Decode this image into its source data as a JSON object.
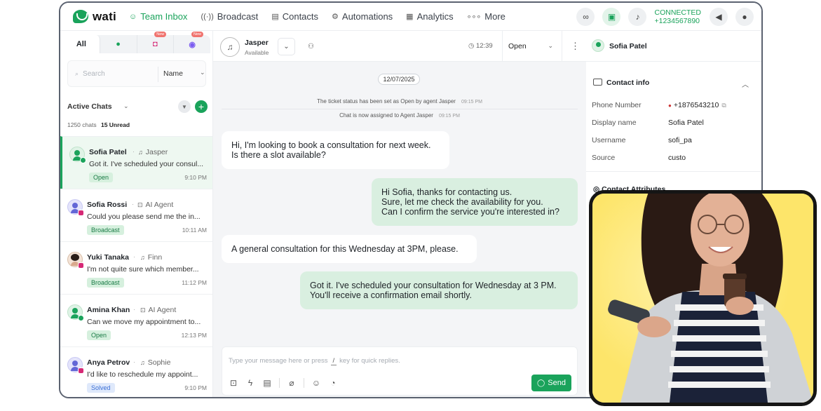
{
  "brand": {
    "name": "wati"
  },
  "nav": {
    "items": [
      {
        "label": "Team Inbox",
        "icon": "inbox-icon",
        "active": true
      },
      {
        "label": "Broadcast",
        "icon": "broadcast-icon"
      },
      {
        "label": "Contacts",
        "icon": "contacts-icon"
      },
      {
        "label": "Automations",
        "icon": "automations-icon"
      },
      {
        "label": "Analytics",
        "icon": "analytics-icon"
      },
      {
        "label": "More",
        "icon": "more-icon"
      }
    ],
    "status": "CONNECTED",
    "phone": "+1234567890"
  },
  "channels": {
    "all": "All",
    "new_badge": "New"
  },
  "search": {
    "placeholder": "Search",
    "sort": "Name"
  },
  "list": {
    "header": "Active Chats",
    "total": "1250 chats",
    "unread": "15 Unread",
    "chats": [
      {
        "name": "Sofia Patel",
        "agent": "Jasper",
        "agent_type": "human",
        "message": "Got it. I've scheduled your consul...",
        "tag": "Open",
        "time": "9:10 PM",
        "source": "whatsapp"
      },
      {
        "name": "Sofia Rossi",
        "agent": "AI Agent",
        "agent_type": "ai",
        "message": "Could you please send me the in...",
        "tag": "Broadcast",
        "time": "10:11 AM",
        "source": "instagram"
      },
      {
        "name": "Yuki Tanaka",
        "agent": "Finn",
        "agent_type": "human",
        "message": "I'm not quite sure which member...",
        "tag": "Broadcast",
        "time": "11:12 PM",
        "source": "instagram"
      },
      {
        "name": "Amina Khan",
        "agent": "AI Agent",
        "agent_type": "ai",
        "message": "Can we move my appointment to...",
        "tag": "Open",
        "time": "12:13 PM",
        "source": "whatsapp"
      },
      {
        "name": "Anya Petrov",
        "agent": "Sophie",
        "agent_type": "human",
        "message": "I'd like to reschedule my appoint...",
        "tag": "Solved",
        "time": "9:10 PM",
        "source": "instagram"
      }
    ]
  },
  "conversation": {
    "agent_name": "Jasper",
    "agent_status": "Available",
    "timer": "12:39",
    "status": "Open",
    "date": "12/07/2025",
    "system": [
      {
        "text": "The ticket status has been set as Open by agent Jasper",
        "time": "09:15 PM"
      },
      {
        "text": "Chat is now assigned to Agent Jasper",
        "time": "09:15 PM"
      }
    ],
    "messages": [
      {
        "dir": "in",
        "lines": [
          "Hi, I'm looking to book a consultation for next week.",
          "Is there a slot available?"
        ]
      },
      {
        "dir": "out",
        "lines": [
          "Hi Sofia, thanks for contacting us.",
          "Sure, let me check the availability for you.",
          "Can I confirm the service you're interested in?"
        ]
      },
      {
        "dir": "in",
        "lines": [
          "A general consultation for this Wednesday at 3PM, please."
        ]
      },
      {
        "dir": "out",
        "lines": [
          "Got it. I've scheduled your consultation for Wednesday at 3 PM.",
          "You'll receive a confirmation email shortly."
        ]
      }
    ],
    "composer_placeholder_a": "Type your message here or press",
    "composer_key": "/",
    "composer_placeholder_b": "key for quick replies.",
    "send_label": "Send"
  },
  "contact": {
    "name": "Sofia Patel",
    "section_title": "Contact info",
    "fields": [
      {
        "label": "Phone Number",
        "value": "+1876543210"
      },
      {
        "label": "Display name",
        "value": "Sofia Patel"
      },
      {
        "label": "Username",
        "value": "sofi_pa"
      },
      {
        "label": "Source",
        "value": "custo"
      }
    ],
    "attributes_title": "Contact Attributes"
  },
  "colors": {
    "brand": "#1aa35b",
    "card": "#fde56a"
  }
}
